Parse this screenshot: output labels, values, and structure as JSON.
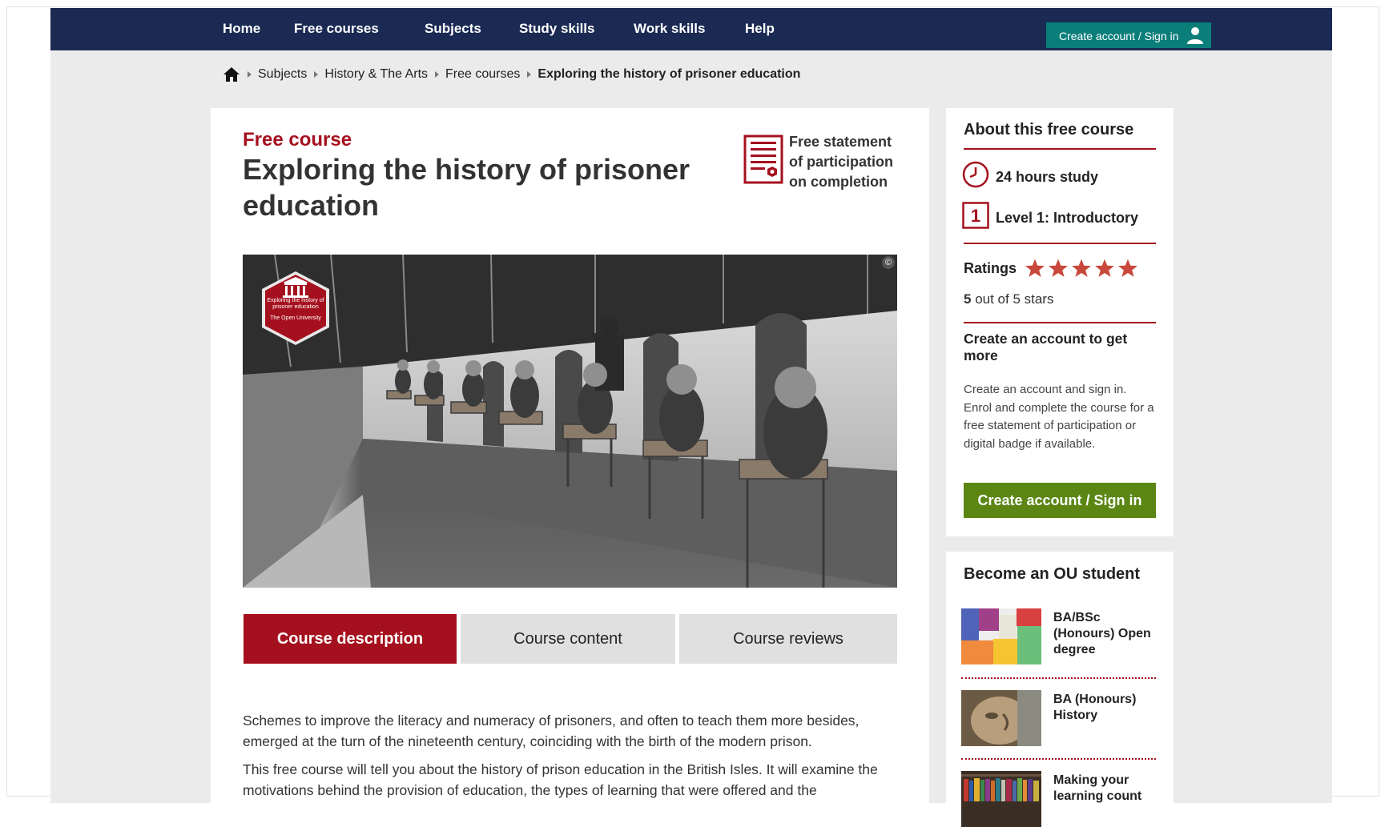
{
  "nav": {
    "items": [
      "Home",
      "Free courses",
      "Subjects",
      "Study skills",
      "Work skills",
      "Help"
    ],
    "signin": "Create account / Sign in"
  },
  "breadcrumb": {
    "items": [
      "Subjects",
      "History & The Arts",
      "Free courses"
    ],
    "current": "Exploring the history of prisoner education"
  },
  "course": {
    "eyebrow": "Free course",
    "title": "Exploring the history of prisoner education",
    "cert_line1": "Free statement",
    "cert_line2": "of participation",
    "cert_line3": "on completion",
    "badge_title": "Exploring the history of prisoner education",
    "badge_org": "The Open University",
    "copyright_symbol": "©"
  },
  "tabs": [
    {
      "label": "Course description",
      "active": true
    },
    {
      "label": "Course content",
      "active": false
    },
    {
      "label": "Course reviews",
      "active": false
    }
  ],
  "description": {
    "p1": "Schemes to improve the literacy and numeracy of prisoners, and often to teach them more besides, emerged at the turn of the nineteenth century, coinciding with the birth of the modern prison.",
    "p2": "This free course will tell you about the history of prison education in the British Isles. It will examine the motivations behind the provision of education, the types of learning that were offered and the"
  },
  "sidebar": {
    "about_title": "About this free course",
    "study_hours": "24 hours study",
    "level_number": "1",
    "level": "Level 1: Introductory",
    "ratings_label": "Ratings",
    "rating_value": 5,
    "rating_value_text": "5",
    "rating_suffix": " out of 5 stars",
    "create_heading": "Create an account to get more",
    "create_text": "Create an account and sign in. Enrol and complete the course for a free statement of participation or digital badge if available.",
    "create_button": "Create account / Sign in"
  },
  "become": {
    "title": "Become an OU student",
    "degrees": [
      {
        "title": "BA/BSc (Honours) Open degree"
      },
      {
        "title": "BA (Honours) History"
      },
      {
        "title": "Making your learning count"
      }
    ]
  },
  "colors": {
    "nav_bg": "#1b2a53",
    "accent_red": "#a5101e",
    "signin_teal": "#0b7e7a",
    "button_green": "#5b8614",
    "star": "#c8493b"
  },
  "icons": {
    "home": "home-icon",
    "user": "user-icon",
    "certificate": "certificate-icon",
    "clock": "clock-icon",
    "star": "star-icon"
  }
}
